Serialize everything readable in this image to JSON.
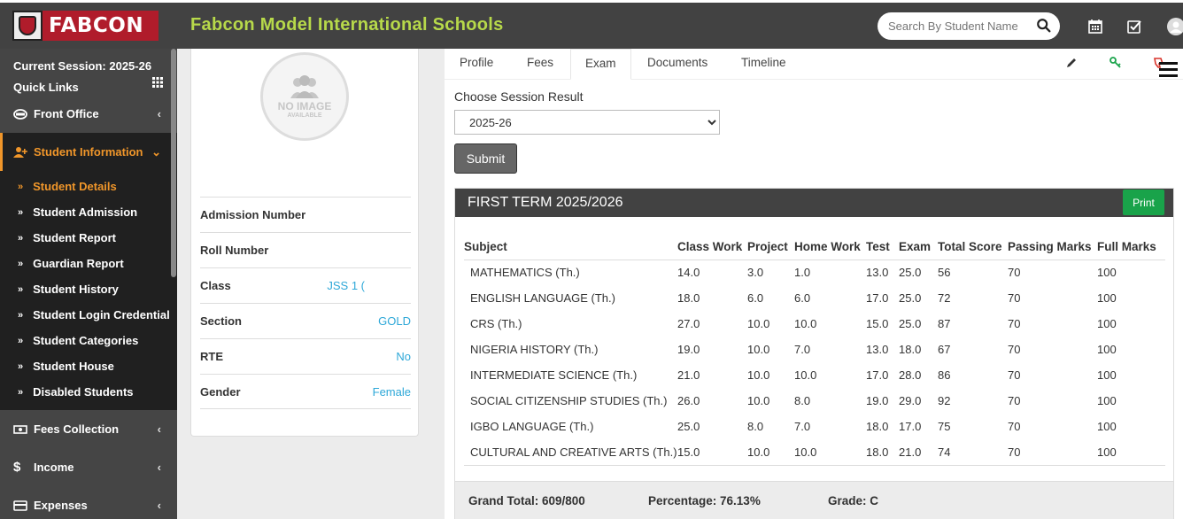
{
  "brand": {
    "logo_text": "FABCON",
    "school_name": "Fabcon Model International Schools",
    "accent": "#b7d94a"
  },
  "search": {
    "placeholder": "Search By Student Name"
  },
  "sidebar": {
    "current_session": "Current Session: 2025-26",
    "quick_links": "Quick Links",
    "items": [
      {
        "label": "Front Office",
        "icon": "front-office-icon"
      },
      {
        "label": "Student Information",
        "icon": "user-plus-icon",
        "active": true
      },
      {
        "label": "Fees Collection",
        "icon": "money-icon"
      },
      {
        "label": "Income",
        "icon": "dollar-icon"
      },
      {
        "label": "Expenses",
        "icon": "card-icon"
      }
    ],
    "submenu": [
      "Student Details",
      "Student Admission",
      "Student Report",
      "Guardian Report",
      "Student History",
      "Student Login Credential",
      "Student Categories",
      "Student House",
      "Disabled Students"
    ]
  },
  "profile": {
    "no_image": "NO IMAGE",
    "available": "AVAILABLE",
    "fields": [
      {
        "label": "Admission Number",
        "value": ""
      },
      {
        "label": "Roll Number",
        "value": ""
      },
      {
        "label": "Class",
        "value": "JSS 1 ("
      },
      {
        "label": "Section",
        "value": "GOLD"
      },
      {
        "label": "RTE",
        "value": "No"
      },
      {
        "label": "Gender",
        "value": "Female"
      }
    ]
  },
  "tabs": [
    "Profile",
    "Fees",
    "Exam",
    "Documents",
    "Timeline"
  ],
  "exam": {
    "session_label": "Choose Session Result",
    "session_value": "2025-26",
    "submit_label": "Submit",
    "term_title": "FIRST TERM 2025/2026",
    "print_label": "Print",
    "columns": [
      "Subject",
      "Class Work",
      "Project",
      "Home Work",
      "Test",
      "Exam",
      "Total Score",
      "Passing Marks",
      "Full Marks"
    ],
    "rows": [
      [
        "MATHEMATICS (Th.)",
        "14.0",
        "3.0",
        "1.0",
        "13.0",
        "25.0",
        "56",
        "70",
        "100"
      ],
      [
        "ENGLISH LANGUAGE (Th.)",
        "18.0",
        "6.0",
        "6.0",
        "17.0",
        "25.0",
        "72",
        "70",
        "100"
      ],
      [
        "CRS (Th.)",
        "27.0",
        "10.0",
        "10.0",
        "15.0",
        "25.0",
        "87",
        "70",
        "100"
      ],
      [
        "NIGERIA HISTORY (Th.)",
        "19.0",
        "10.0",
        "7.0",
        "13.0",
        "18.0",
        "67",
        "70",
        "100"
      ],
      [
        "INTERMEDIATE SCIENCE (Th.)",
        "21.0",
        "10.0",
        "10.0",
        "17.0",
        "28.0",
        "86",
        "70",
        "100"
      ],
      [
        "SOCIAL CITIZENSHIP STUDIES (Th.)",
        "26.0",
        "10.0",
        "8.0",
        "19.0",
        "29.0",
        "92",
        "70",
        "100"
      ],
      [
        "IGBO LANGUAGE (Th.)",
        "25.0",
        "8.0",
        "7.0",
        "18.0",
        "17.0",
        "75",
        "70",
        "100"
      ],
      [
        "CULTURAL AND CREATIVE ARTS (Th.)",
        "15.0",
        "10.0",
        "10.0",
        "18.0",
        "21.0",
        "74",
        "70",
        "100"
      ]
    ],
    "grand_total": "Grand Total: 609/800",
    "percentage": "Percentage: 76.13%",
    "grade": "Grade: C"
  }
}
